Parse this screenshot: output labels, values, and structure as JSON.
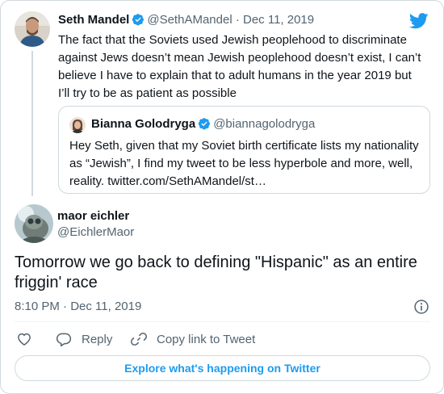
{
  "colors": {
    "accent": "#1d9bf0",
    "text_primary": "#0f1419",
    "text_secondary": "#536471",
    "border": "#cfd9de"
  },
  "icons": {
    "brand": "twitter-bird-icon",
    "verified": "verified-badge-icon",
    "like": "heart-icon",
    "reply": "reply-bubble-icon",
    "copy_link": "link-icon",
    "info": "info-icon"
  },
  "parent_tweet": {
    "name": "Seth Mandel",
    "handle": "@SethAMandel",
    "separator": "·",
    "date": "Dec 11, 2019",
    "text": "The fact that the Soviets used Jewish peoplehood to discriminate against Jews doesn’t mean Jewish peoplehood doesn’t exist, I can’t believe I have to explain that to adult humans in the year 2019 but I’ll try to be as patient as possible",
    "quoted_tweet": {
      "name": "Bianna Golodryga",
      "handle": "@biannagolodryga",
      "text": "Hey Seth, given that my Soviet birth certificate lists my nationality as “Jewish”, I find my tweet to be less hyperbole and more, well, reality. twitter.com/SethAMandel/st…"
    }
  },
  "main_tweet": {
    "name": "maor eichler",
    "handle": "@EichlerMaor",
    "text": "Tomorrow we go back to defining \"Hispanic\" as an entire friggin' race",
    "timestamp": "8:10 PM · Dec 11, 2019"
  },
  "actions": {
    "reply_label": "Reply",
    "copy_link_label": "Copy link to Tweet"
  },
  "explore_label": "Explore what's happening on Twitter"
}
